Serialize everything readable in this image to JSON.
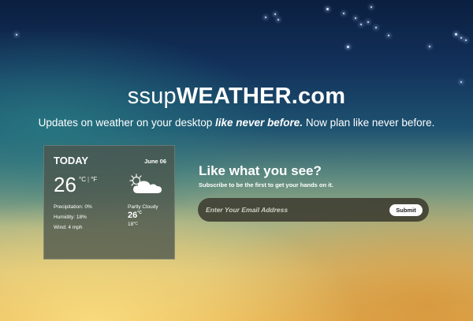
{
  "brand": {
    "prefix": "ssup",
    "name": "WEATHER.com"
  },
  "tagline": {
    "before": "Updates on weather on your desktop ",
    "emphasis": "like never before.",
    "after": " Now plan like never before."
  },
  "widget": {
    "day": "TODAY",
    "date": "June 06",
    "temperature": "26",
    "unit_c": "°C",
    "unit_f": "°F",
    "weather_icon": "partly-cloudy-icon",
    "details": {
      "precipitation": "Precipitation: 0%",
      "humidity": "Humidity: 18%",
      "wind": "Wind: 4 mph"
    },
    "condition": "Partly Cloudy",
    "high": "26",
    "high_unit": "°C",
    "low": "18",
    "low_unit": "°C"
  },
  "cta": {
    "title": "Like what you see?",
    "subtitle": "Subscribe to be the first to get your hands on it.",
    "email_placeholder": "Enter Your Email Address",
    "submit_label": "Submit"
  },
  "colors": {
    "sky_top": "#0b1f3f",
    "horizon": "#5d8a7f",
    "sunset": "#e5ad4d",
    "widget_bg": "#4b554b",
    "form_bg": "#3e3e32"
  }
}
